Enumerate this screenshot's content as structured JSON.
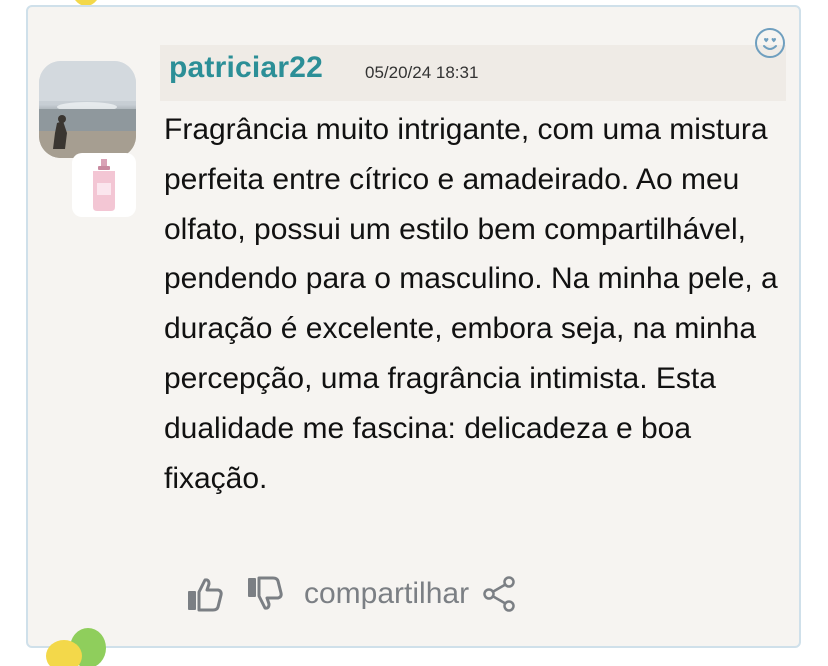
{
  "review": {
    "username": "patriciar22",
    "timestamp": "05/20/24 18:31",
    "text": "Fragrância muito intrigante, com uma mistura perfeita entre cítrico e amadeirado. Ao meu olfato, possui um estilo bem compartilhável, pendendo para o masculino. Na minha pele, a duração é excelente, embora seja, na minha percepção, uma fragrância intimista. Esta dualidade me fascina: delicadeza e boa fixação."
  },
  "actions": {
    "share_label": "compartilhar"
  },
  "icons": {
    "reaction": "heart-eyes-smiley-icon",
    "like": "thumbs-up-icon",
    "dislike": "thumbs-down-icon",
    "share": "share-icon"
  },
  "colors": {
    "username": "#2c8f97",
    "card_background": "#f6f4f1",
    "card_border": "#cfe0ea",
    "action_icons": "#7b7f84"
  }
}
